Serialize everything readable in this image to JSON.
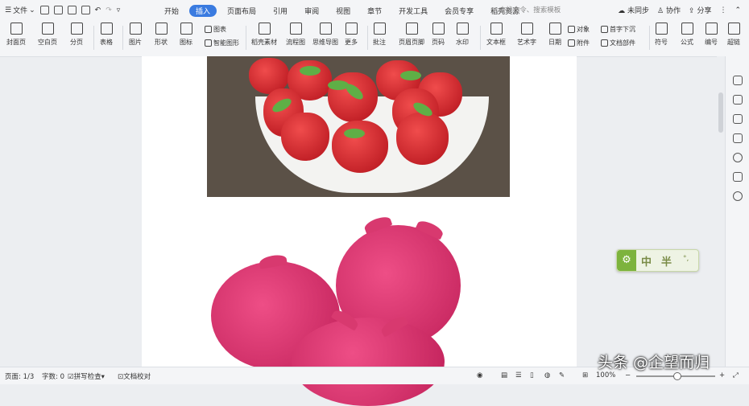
{
  "titlebar": {
    "file_menu": "文件",
    "tabs": [
      "开始",
      "插入",
      "页面布局",
      "引用",
      "审阅",
      "视图",
      "章节",
      "开发工具",
      "会员专享",
      "稻壳资源"
    ],
    "active_tab": "插入",
    "search_placeholder": "查找命令、搜索模板",
    "sync": "未同步",
    "collab": "协作",
    "share": "分享"
  },
  "ribbon": {
    "cover": "封面页",
    "blank": "空白页",
    "pagebreak": "分页",
    "table": "表格",
    "picture": "图片",
    "shape": "形状",
    "icon": "图标",
    "chart": "图表",
    "smartart": "智能图形",
    "docer": "稻壳素材",
    "flow": "流程图",
    "mindmap": "思维导图",
    "more": "更多",
    "comment": "批注",
    "header": "页眉页脚",
    "pagenum": "页码",
    "watermark": "水印",
    "textbox": "文本框",
    "wordart": "艺术字",
    "date": "日期",
    "object": "对象",
    "attach": "附件",
    "dropcap": "首字下沉",
    "docpart": "文档部件",
    "symbol": "符号",
    "formula": "公式",
    "numbering": "编号",
    "link": "超链"
  },
  "widget": {
    "char1": "中",
    "char2": "半",
    "char3": "°,"
  },
  "status": {
    "page": "页面: 1/3",
    "words": "字数: 0",
    "spell": "拼写检查",
    "proof": "文档校对",
    "zoom": "100%"
  },
  "watermark_text": "头条 @企望而归",
  "colors": {
    "accent": "#3a7be0",
    "ime_green": "#7db33d"
  }
}
